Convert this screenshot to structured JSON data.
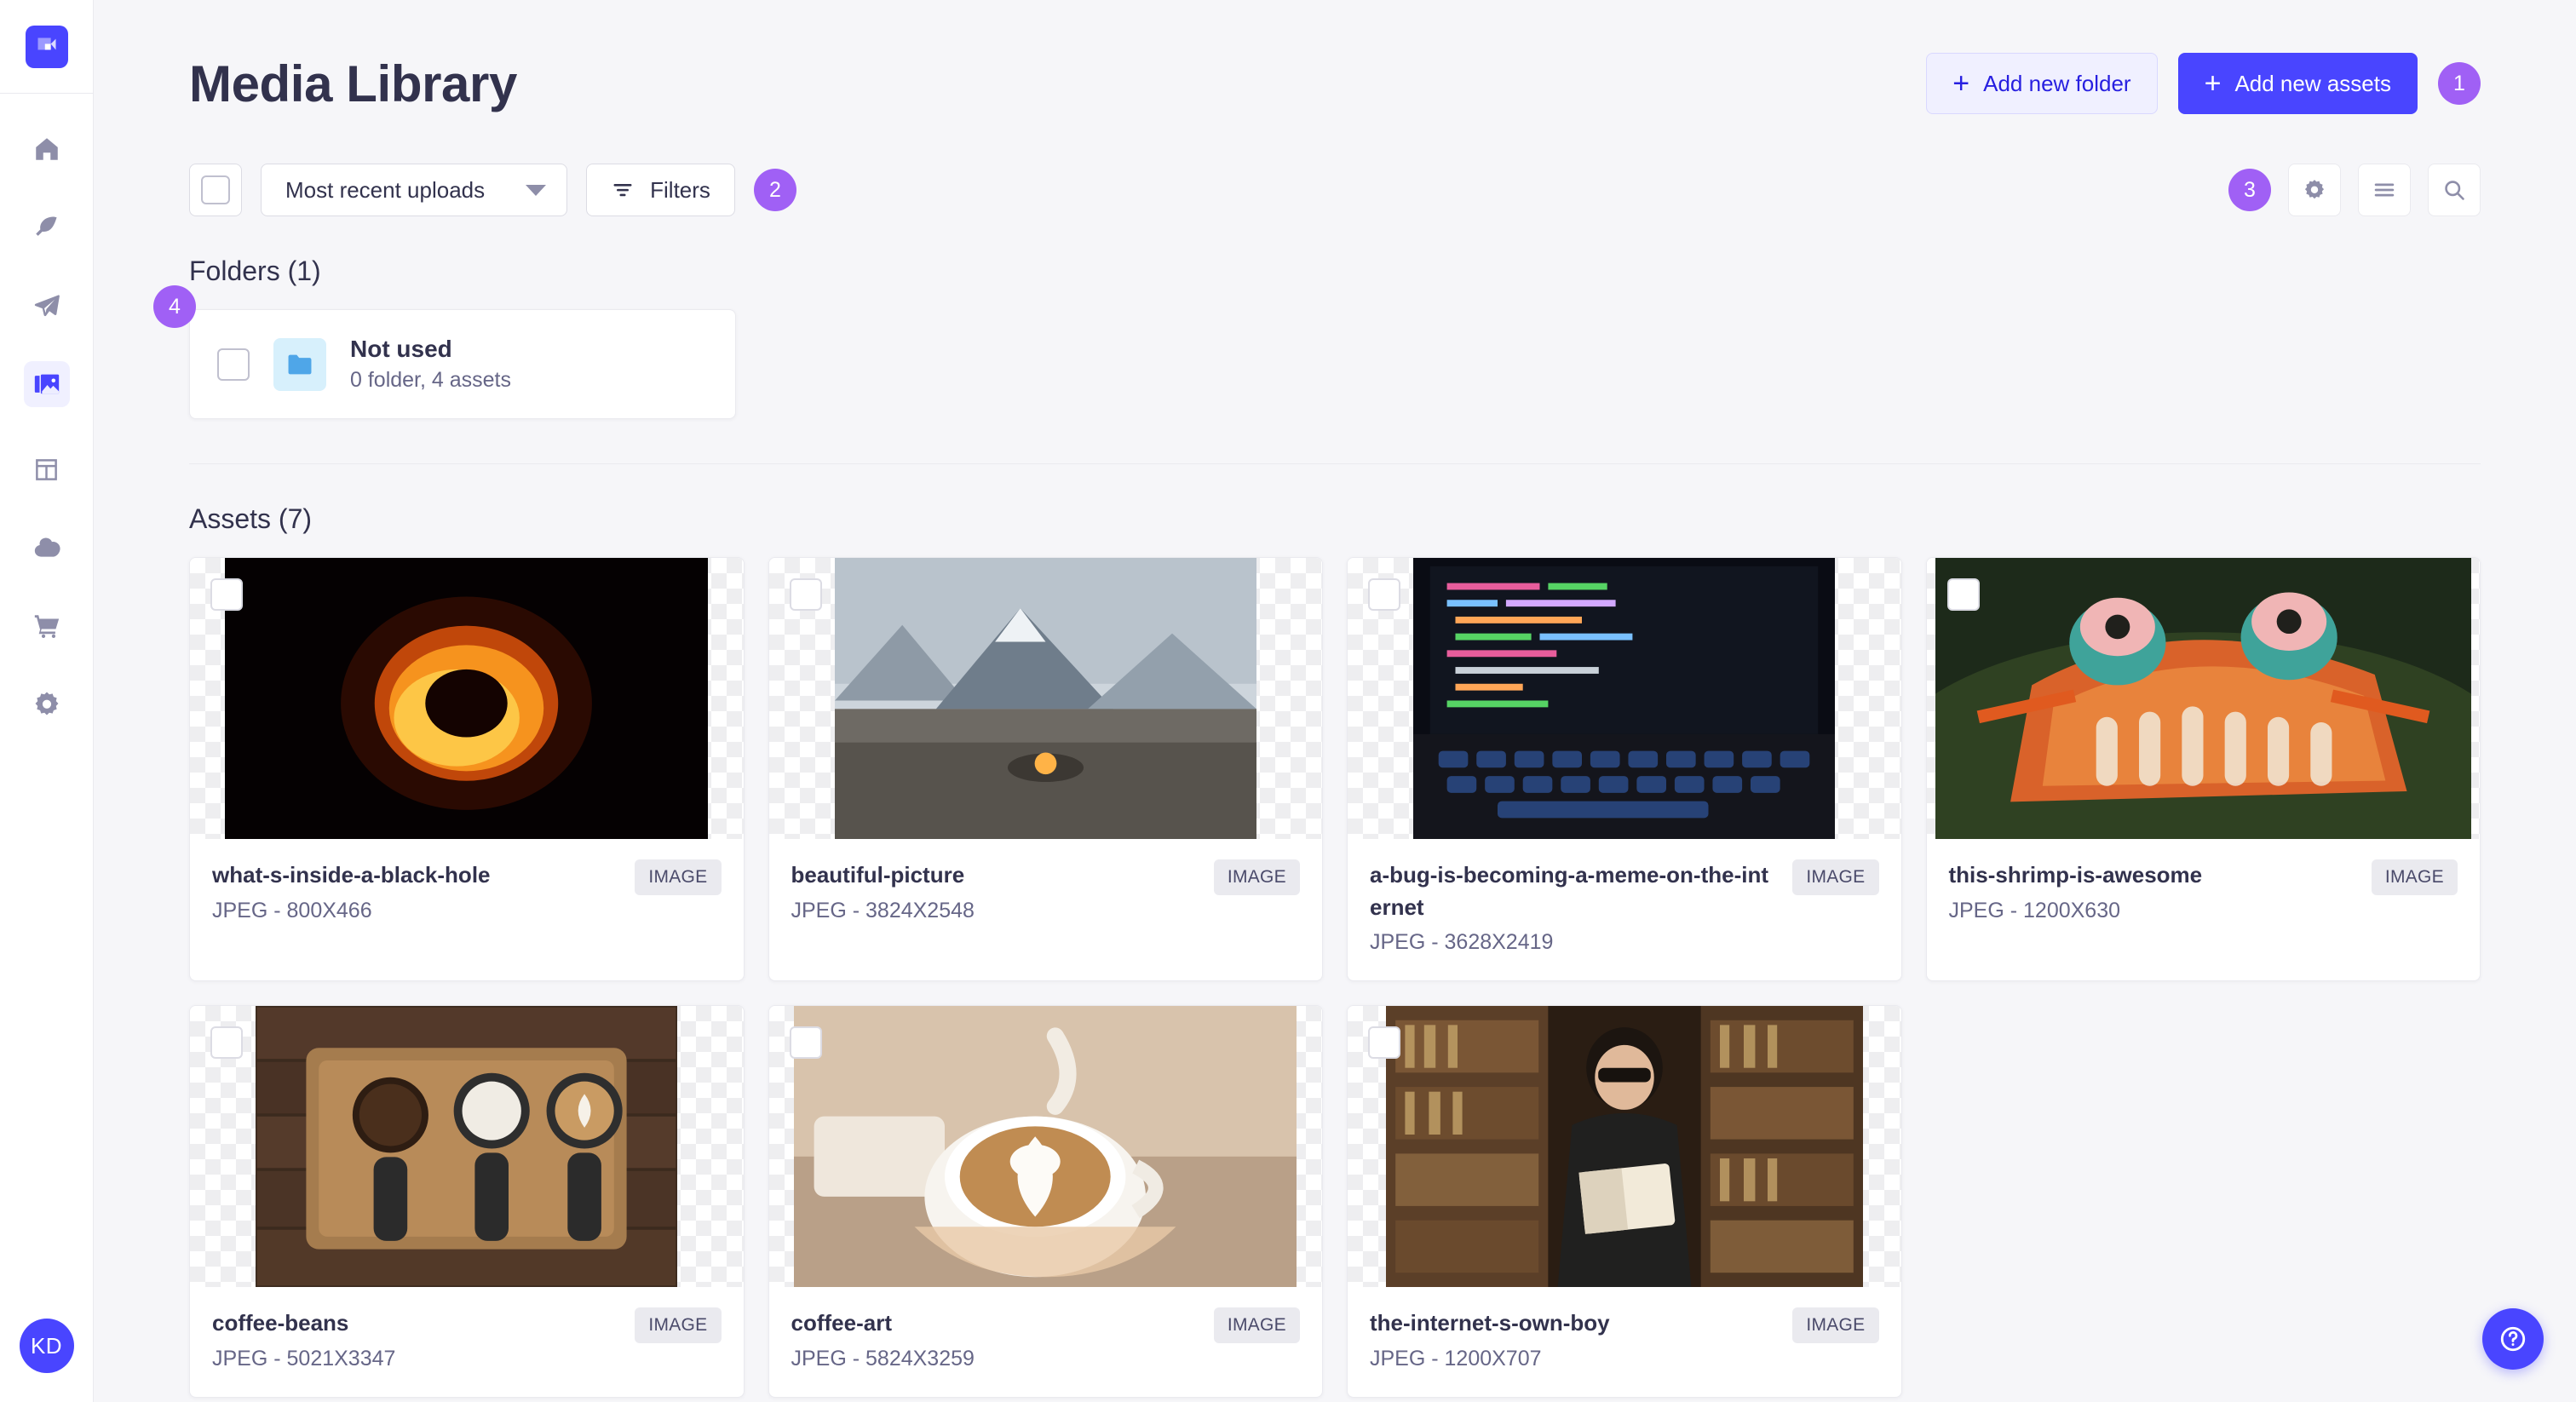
{
  "app": {
    "logo_icon": "strapi-logo-icon",
    "avatar_initials": "KD",
    "help_icon": "help-question-icon"
  },
  "sidebar": {
    "items": [
      {
        "icon": "home-icon",
        "name": "home",
        "active": false
      },
      {
        "icon": "feather-pen-icon",
        "name": "content-manager",
        "active": false
      },
      {
        "icon": "paper-plane-icon",
        "name": "deploy",
        "active": false
      },
      {
        "icon": "picture-icon",
        "name": "media-library",
        "active": true
      },
      {
        "icon": "layout-icon",
        "name": "content-type-builder",
        "active": false
      },
      {
        "icon": "cloud-icon",
        "name": "cloud",
        "active": false
      },
      {
        "icon": "shopping-cart-icon",
        "name": "marketplace",
        "active": false
      },
      {
        "icon": "gear-icon",
        "name": "settings",
        "active": false
      }
    ]
  },
  "header": {
    "title": "Media Library",
    "add_folder_label": "Add new folder",
    "add_assets_label": "Add new assets",
    "plus_glyph": "+",
    "badge_1": "1"
  },
  "toolbar": {
    "sort_value": "Most recent uploads",
    "filters_label": "Filters",
    "badge_2": "2",
    "badge_3": "3",
    "settings_icon": "gear-icon",
    "list_view_icon": "list-view-icon",
    "search_icon": "search-icon",
    "filter_icon": "filter-funnel-icon",
    "select_all_icon": "checkbox-unchecked"
  },
  "folders": {
    "section_title": "Folders (1)",
    "badge_4": "4",
    "items": [
      {
        "name": "Not used",
        "subtitle": "0 folder, 4 assets",
        "icon": "folder-icon",
        "icon_bg": "#D7F0FC",
        "icon_color": "#4FA6E8"
      }
    ]
  },
  "assets": {
    "section_title": "Assets (7)",
    "tag_label": "IMAGE",
    "items": [
      {
        "name": "what-s-inside-a-black-hole",
        "ext": "JPEG - 800X466",
        "tag": "IMAGE",
        "thumb": "black-hole",
        "aspect": 1.717
      },
      {
        "name": "beautiful-picture",
        "ext": "JPEG - 3824X2548",
        "tag": "IMAGE",
        "thumb": "mountains",
        "aspect": 1.501
      },
      {
        "name": "a-bug-is-becoming-a-meme-on-the-internet",
        "ext": "JPEG - 3628X2419",
        "tag": "IMAGE",
        "thumb": "laptop-code",
        "aspect": 1.5
      },
      {
        "name": "this-shrimp-is-awesome",
        "ext": "JPEG - 1200X630",
        "tag": "IMAGE",
        "thumb": "shrimp",
        "aspect": 1.905
      },
      {
        "name": "coffee-beans",
        "ext": "JPEG - 5021X3347",
        "tag": "IMAGE",
        "thumb": "coffee-beans",
        "aspect": 1.5
      },
      {
        "name": "coffee-art",
        "ext": "JPEG - 5824X3259",
        "tag": "IMAGE",
        "thumb": "coffee-art",
        "aspect": 1.787
      },
      {
        "name": "the-internet-s-own-boy",
        "ext": "JPEG - 1200X707",
        "tag": "IMAGE",
        "thumb": "library-man",
        "aspect": 1.697
      }
    ]
  },
  "colors": {
    "primary": "#4945FF",
    "primary_light": "#F0F0FF",
    "primary_border": "#D9D8FF",
    "primary_text": "#271FE0",
    "badge": "#A060F5",
    "text_dark": "#32324D",
    "text_muted": "#666687",
    "page_bg": "#F6F6F9",
    "border": "#EAEAEF"
  }
}
